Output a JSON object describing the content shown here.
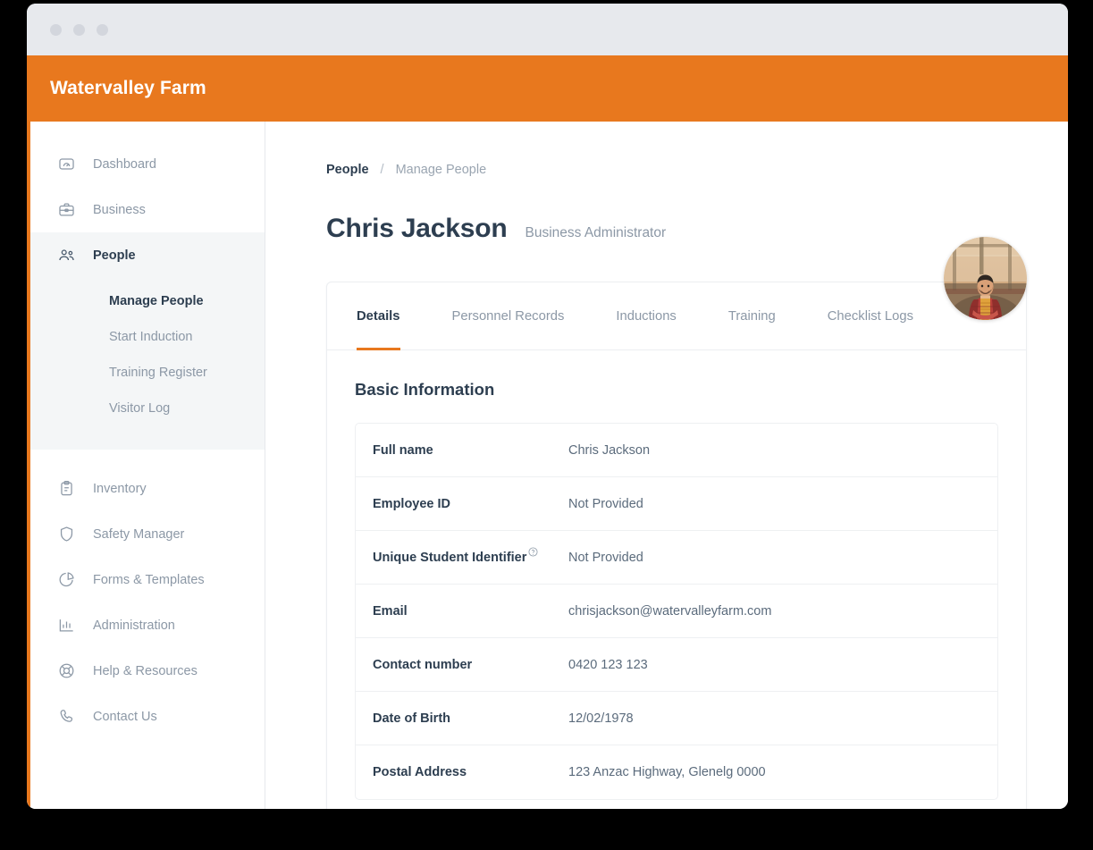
{
  "window": {
    "dots": [
      "window-dot-1",
      "window-dot-2",
      "window-dot-3"
    ]
  },
  "header": {
    "app_title": "Watervalley Farm",
    "brand_color": "#e8781e"
  },
  "sidebar": {
    "items": [
      {
        "label": "Dashboard",
        "icon": "gauge-icon",
        "active": false
      },
      {
        "label": "Business",
        "icon": "briefcase-icon",
        "active": false
      },
      {
        "label": "People",
        "icon": "people-icon",
        "active": true
      },
      {
        "label": "Inventory",
        "icon": "clipboard-icon",
        "active": false
      },
      {
        "label": "Safety Manager",
        "icon": "shield-icon",
        "active": false
      },
      {
        "label": "Forms & Templates",
        "icon": "pie-chart-icon",
        "active": false
      },
      {
        "label": "Administration",
        "icon": "bar-chart-icon",
        "active": false
      },
      {
        "label": "Help & Resources",
        "icon": "life-ring-icon",
        "active": false
      },
      {
        "label": "Contact Us",
        "icon": "phone-icon",
        "active": false
      }
    ],
    "people_subitems": [
      {
        "label": "Manage People",
        "active": true
      },
      {
        "label": "Start Induction",
        "active": false
      },
      {
        "label": "Training Register",
        "active": false
      },
      {
        "label": "Visitor Log",
        "active": false
      }
    ],
    "accent_color": "#e8781e",
    "active_bg": "#f4f6f7"
  },
  "breadcrumb": {
    "root": "People",
    "separator": "/",
    "current": "Manage People"
  },
  "person": {
    "name": "Chris Jackson",
    "role": "Business Administrator",
    "avatar": "person-photo-avatar"
  },
  "tabs": [
    {
      "label": "Details",
      "active": true
    },
    {
      "label": "Personnel Records",
      "active": false
    },
    {
      "label": "Inductions",
      "active": false
    },
    {
      "label": "Training",
      "active": false
    },
    {
      "label": "Checklist Logs",
      "active": false
    }
  ],
  "basic_information": {
    "section_title": "Basic Information",
    "rows": [
      {
        "label": "Full name",
        "value": "Chris Jackson",
        "help": false
      },
      {
        "label": "Employee ID",
        "value": "Not Provided",
        "help": false
      },
      {
        "label": "Unique Student Identifier",
        "value": "Not Provided",
        "help": true
      },
      {
        "label": "Email",
        "value": "chrisjackson@watervalleyfarm.com",
        "help": false
      },
      {
        "label": "Contact number",
        "value": "0420 123 123",
        "help": false
      },
      {
        "label": "Date of Birth",
        "value": "12/02/1978",
        "help": false
      },
      {
        "label": "Postal Address",
        "value": "123 Anzac Highway, Glenelg 0000",
        "help": false
      }
    ]
  }
}
